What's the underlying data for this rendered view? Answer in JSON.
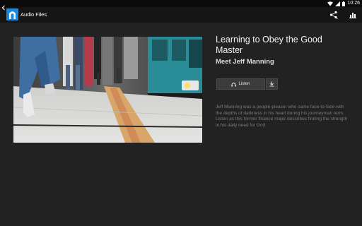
{
  "statusbar": {
    "time": "10:26",
    "icons": [
      "wifi-icon",
      "signal-icon",
      "battery-icon"
    ]
  },
  "actionbar": {
    "title": "Audio Files",
    "icons": [
      "back-arrow-icon",
      "app-logo-icon",
      "share-icon",
      "stats-icon"
    ]
  },
  "content": {
    "title": "Learning to Obey the Good Master",
    "subtitle": "Meet Jeff Manning",
    "listen_label": "Listen",
    "listen_icon": "headphones-icon",
    "download_icon": "download-icon",
    "description": "Jeff Manning was a people-pleaser who came face-to-face with the depths of darkness in his heart during his journeyman term. Listen as this former finance major describes finding the strength in his daily need for God."
  },
  "colors": {
    "background": "#222222",
    "statusbar": "#0b0b0b",
    "actionbar": "#151515",
    "app_icon": "#1e88d8",
    "button": "#3b3b3b",
    "train": "#2a8c96"
  }
}
